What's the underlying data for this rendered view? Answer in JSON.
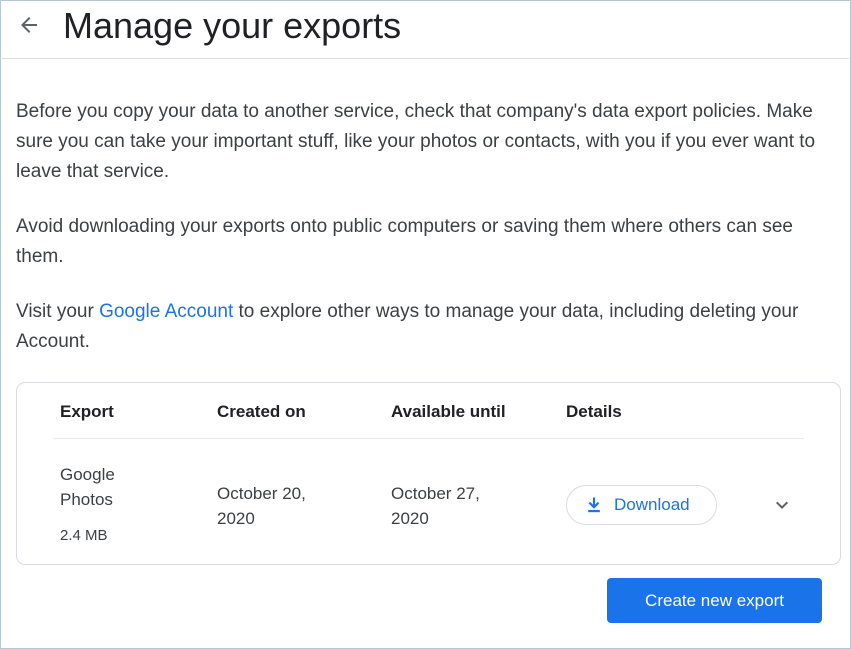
{
  "header": {
    "title": "Manage your exports",
    "back_icon": "arrow-left-icon"
  },
  "intro": {
    "p1": "Before you copy your data to another service, check that company's data export policies. Make sure you can take your important stuff, like your photos or contacts, with you if you ever want to leave that service.",
    "p2": "Avoid downloading your exports onto public computers or saving them where others can see them.",
    "p3_prefix": "Visit your ",
    "p3_link": "Google Account",
    "p3_suffix": " to explore other ways to manage your data, including deleting your Account."
  },
  "table": {
    "headers": {
      "export": "Export",
      "created": "Created on",
      "available": "Available until",
      "details": "Details"
    },
    "rows": [
      {
        "name_line1": "Google",
        "name_line2": "Photos",
        "size": "2.4 MB",
        "created_line1": "October 20,",
        "created_line2": "2020",
        "available_line1": "October 27,",
        "available_line2": "2020",
        "download_label": "Download",
        "download_icon": "download-icon",
        "expand_icon": "chevron-down-icon"
      }
    ]
  },
  "actions": {
    "create_label": "Create new export"
  },
  "colors": {
    "accent": "#1a73e8",
    "text": "#202124",
    "border": "#dadce0"
  }
}
